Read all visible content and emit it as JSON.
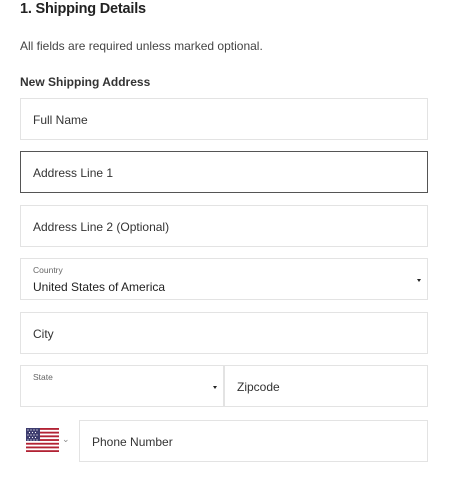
{
  "header": {
    "title": "1. Shipping Details",
    "subtitle": "All fields are required unless marked optional.",
    "section_label": "New Shipping Address"
  },
  "form": {
    "full_name": {
      "placeholder": "Full Name"
    },
    "address1": {
      "placeholder": "Address Line 1"
    },
    "address2": {
      "placeholder": "Address Line 2 (Optional)"
    },
    "country": {
      "label": "Country",
      "value": "United States of America"
    },
    "city": {
      "placeholder": "City"
    },
    "state": {
      "label": "State",
      "value": ""
    },
    "zipcode": {
      "placeholder": "Zipcode"
    },
    "phone": {
      "placeholder": "Phone Number",
      "country_flag": "us-flag-icon"
    }
  },
  "colors": {
    "border": "#e3e3e3",
    "focus_border": "#555555",
    "flag_red": "#b22234",
    "flag_blue": "#3c3b6e"
  }
}
